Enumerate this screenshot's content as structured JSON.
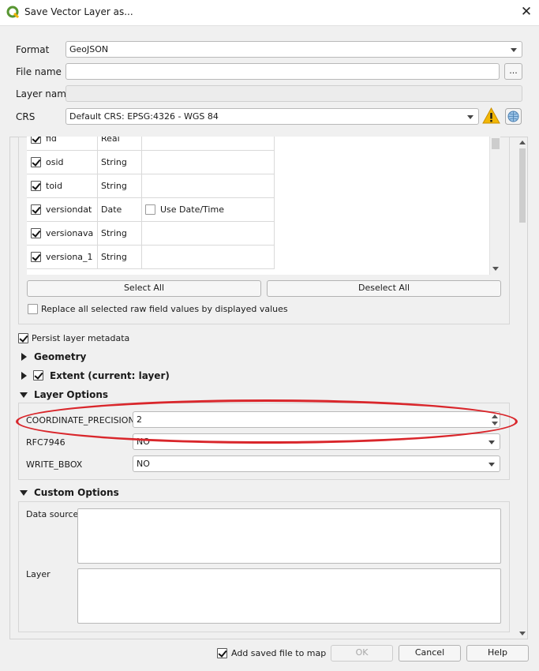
{
  "window": {
    "title": "Save Vector Layer as...",
    "close_glyph": "✕"
  },
  "form": {
    "format_label": "Format",
    "format_value": "GeoJSON",
    "filename_label": "File name",
    "filename_value": "",
    "browse_label": "...",
    "layername_label": "Layer name",
    "layername_value": "",
    "crs_label": "CRS",
    "crs_value": "Default CRS: EPSG:4326 - WGS 84"
  },
  "fields": {
    "rows": [
      {
        "name": "fid",
        "type": "Real",
        "checked": true,
        "extra": ""
      },
      {
        "name": "osid",
        "type": "String",
        "checked": true,
        "extra": ""
      },
      {
        "name": "toid",
        "type": "String",
        "checked": true,
        "extra": ""
      },
      {
        "name": "versiondat",
        "type": "Date",
        "checked": true,
        "extra": "Use Date/Time"
      },
      {
        "name": "versionava",
        "type": "String",
        "checked": true,
        "extra": ""
      },
      {
        "name": "versiona_1",
        "type": "String",
        "checked": true,
        "extra": ""
      }
    ],
    "select_all": "Select All",
    "deselect_all": "Deselect All",
    "replace_raw": "Replace all selected raw field values by displayed values"
  },
  "persist_metadata": "Persist layer metadata",
  "geometry_title": "Geometry",
  "extent_title": "Extent (current: layer)",
  "layer_options": {
    "title": "Layer Options",
    "coord_label": "COORDINATE_PRECISION",
    "coord_value": "2",
    "rfc_label": "RFC7946",
    "rfc_value": "NO",
    "bbox_label": "WRITE_BBOX",
    "bbox_value": "NO"
  },
  "custom_options": {
    "title": "Custom Options",
    "datasource_label": "Data source",
    "layer_label": "Layer"
  },
  "footer": {
    "add_saved": "Add saved file to map",
    "ok": "OK",
    "cancel": "Cancel",
    "help": "Help"
  },
  "colors": {
    "highlight_oval": "#d9262b",
    "warning": "#f2b705",
    "qgis_green": "#589632"
  }
}
